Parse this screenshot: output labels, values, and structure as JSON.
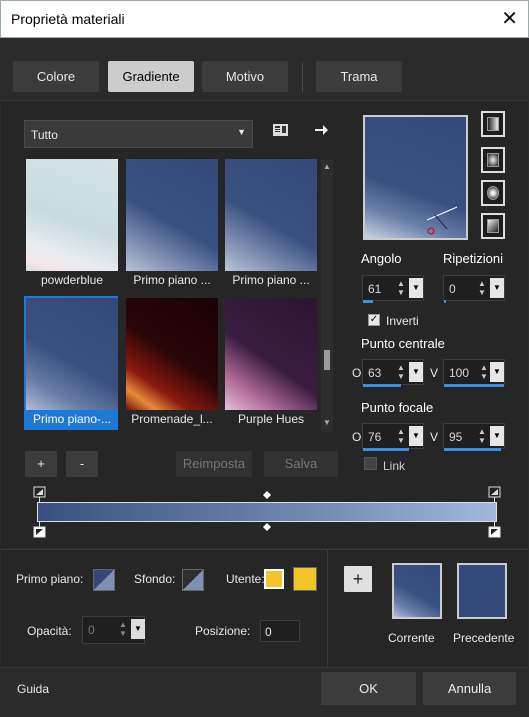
{
  "window": {
    "title": "Proprietà materiali",
    "close": "✕"
  },
  "tabs": [
    {
      "label": "Colore",
      "active": false
    },
    {
      "label": "Gradiente",
      "active": true
    },
    {
      "label": "Motivo",
      "active": false
    },
    {
      "label": "Trama",
      "active": false
    }
  ],
  "category": {
    "value": "Tutto"
  },
  "gallery": [
    {
      "label": "powderblue",
      "selected": false
    },
    {
      "label": "Primo piano ...",
      "selected": false
    },
    {
      "label": "Primo piano ...",
      "selected": false
    },
    {
      "label": "Primo piano-...",
      "selected": true
    },
    {
      "label": "Promenade_l...",
      "selected": false
    },
    {
      "label": "Purple Hues",
      "selected": false
    }
  ],
  "controls": {
    "angle_label": "Angolo",
    "angle": "61",
    "repeats_label": "Ripetizioni",
    "repeats": "0",
    "invert_label": "Inverti",
    "invert_checked": true,
    "center_label": "Punto centrale",
    "center_o": "63",
    "center_v": "100",
    "focal_label": "Punto focale",
    "focal_o": "76",
    "focal_v": "95",
    "link_label": "Link",
    "o_prefix": "O",
    "v_prefix": "V"
  },
  "buttons": {
    "add": "+",
    "remove": "-",
    "reset": "Reimposta",
    "save": "Salva",
    "ok": "OK",
    "cancel": "Annulla",
    "help": "Guida",
    "plus": "+"
  },
  "bottom": {
    "foreground_label": "Primo piano:",
    "background_label": "Sfondo:",
    "user_label": "Utente:",
    "opacity_label": "Opacità:",
    "opacity": "0",
    "position_label": "Posizione:",
    "position": "0",
    "current_label": "Corrente",
    "previous_label": "Precedente"
  },
  "colors": {
    "accent": "#1e78d6",
    "user_swatch": "#f2c62b",
    "gradient_start": "#3a5080",
    "gradient_end": "#a3b6dc"
  }
}
